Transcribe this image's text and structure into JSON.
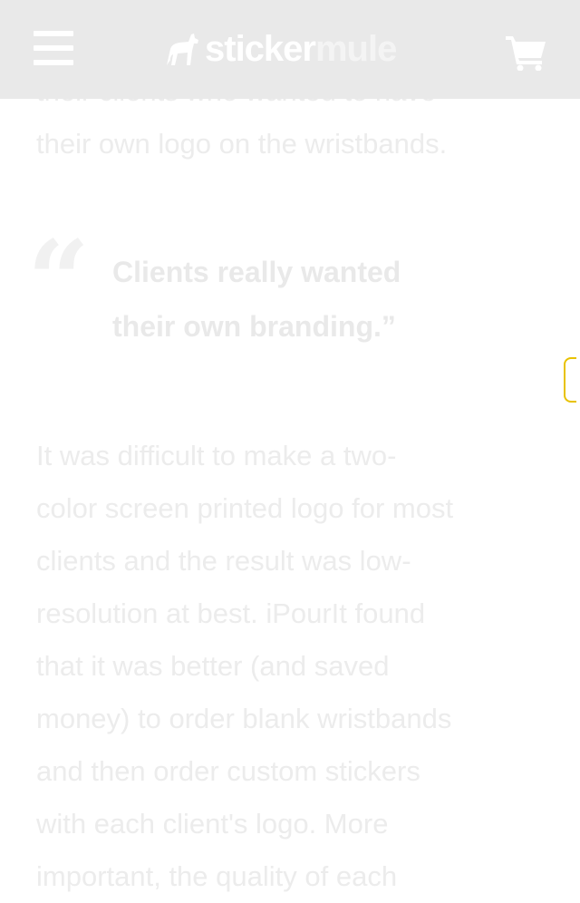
{
  "header": {
    "logo_part1": "sticker",
    "logo_part2": "mule",
    "menu_icon": "hamburger-icon",
    "cart_icon": "cart-icon"
  },
  "intro": {
    "lines": [
      "their clients who wanted to have",
      "their own logo on the wristbands."
    ]
  },
  "quote": {
    "lines": [
      "Clients really wanted",
      "their own branding.”"
    ]
  },
  "body": {
    "lines": [
      "It was difficult to make a two-",
      "color screen printed logo for most",
      "clients and the result was low-",
      "resolution at best. iPourIt found",
      "that it was better (and saved",
      "money) to order blank wristbands",
      "and then order custom stickers",
      "with each client's logo. More",
      "important, the quality of each"
    ]
  },
  "colors": {
    "header_bg": "#e9e9e9",
    "text": "#ececec",
    "scroll_accent": "#e8c200"
  }
}
